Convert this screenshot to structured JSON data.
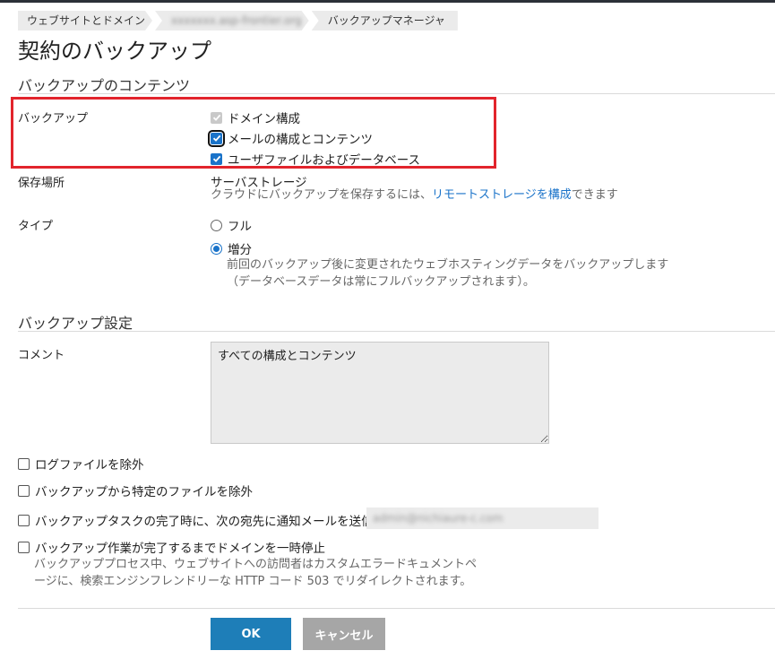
{
  "breadcrumb": [
    "ウェブサイトとドメイン",
    "xxxxxxx.asp-frontier.org",
    "バックアップマネージャ"
  ],
  "page_title": "契約のバックアップ",
  "content_section": {
    "title": "バックアップのコンテンツ",
    "backup_label": "バックアップ",
    "options": [
      {
        "label": "ドメイン構成",
        "checked": true,
        "disabled": true
      },
      {
        "label": "メールの構成とコンテンツ",
        "checked": true,
        "focused": true
      },
      {
        "label": "ユーザファイルおよびデータベース",
        "checked": true
      }
    ],
    "storage_label": "保存場所",
    "storage_value": "サーバストレージ",
    "storage_hint_prefix": "クラウドにバックアップを保存するには、",
    "storage_hint_link": "リモートストレージを構成",
    "storage_hint_suffix": "できます",
    "type_label": "タイプ",
    "type_options": [
      {
        "label": "フル",
        "selected": false
      },
      {
        "label": "増分",
        "selected": true
      }
    ],
    "incremental_hint_1": "前回のバックアップ後に変更されたウェブホスティングデータをバックアップします",
    "incremental_hint_2": "（データベースデータは常にフルバックアップされます）。"
  },
  "settings_section": {
    "title": "バックアップ設定",
    "comment_label": "コメント",
    "comment_value": "すべての構成とコンテンツ",
    "exclude_logs": "ログファイルを除外",
    "exclude_files": "バックアップから特定のファイルを除外",
    "notify_label": "バックアップタスクの完了時に、次の宛先に通知メールを送信",
    "notify_email": "admin@nichiaure-c.com",
    "suspend_label": "バックアップ作業が完了するまでドメインを一時停止",
    "suspend_hint_1": "バックアッププロセス中、ウェブサイトへの訪問者はカスタムエラードキュメントペ",
    "suspend_hint_2": "ージに、検索エンジンフレンドリーな HTTP コード 503 でリダイレクトされます。"
  },
  "buttons": {
    "ok": "OK",
    "cancel": "キャンセル"
  },
  "colors": {
    "accent": "#1a73c9",
    "highlight": "#e2242c",
    "ok_button": "#1e7eb8",
    "cancel_button": "#a6a6a6"
  }
}
